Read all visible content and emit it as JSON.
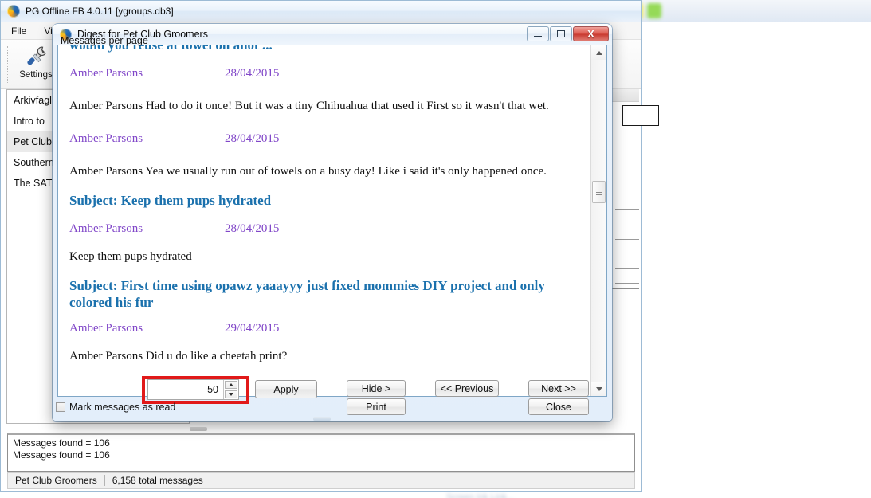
{
  "main_window": {
    "title": "PG Offline FB 4.0.11  [ygroups.db3]",
    "icon": "app-swirl-icon",
    "menu": [
      "File",
      "Vie"
    ],
    "toolbar": {
      "settings_label": "Settings",
      "settings_icon": "tools-settings-icon"
    },
    "group_list": [
      {
        "label": "Arkivfagl",
        "selected": false
      },
      {
        "label": "Intro to ",
        "selected": false
      },
      {
        "label": "Pet Club",
        "selected": true
      },
      {
        "label": "Southern",
        "selected": false
      },
      {
        "label": "The SAT",
        "selected": false
      }
    ],
    "log_lines": [
      "Messages found = 106",
      "Messages found = 106"
    ],
    "status_bar": {
      "group": "Pet Club Groomers",
      "total": "6,158 total messages"
    }
  },
  "dialog": {
    "title": "Digest for Pet Club Groomers",
    "icon": "app-swirl-icon",
    "window_buttons": {
      "minimize": "minimize-icon",
      "maximize": "maximize-icon",
      "close": "X"
    },
    "messages": [
      {
        "type": "subject",
        "clipped": true,
        "text": "would you reuse at towel on anot ..."
      },
      {
        "type": "meta",
        "author": "Amber Parsons",
        "date": "28/04/2015"
      },
      {
        "type": "body",
        "text": "Amber Parsons Had to do it once! But it was a tiny Chihuahua that used it First so it wasn't that wet."
      },
      {
        "type": "meta",
        "author": "Amber Parsons",
        "date": "28/04/2015"
      },
      {
        "type": "body",
        "text": "Amber Parsons Yea we usually run out of towels on a busy day! Like i said it's only happened once."
      },
      {
        "type": "subject",
        "clipped": false,
        "text": "Subject: Keep them pups hydrated"
      },
      {
        "type": "meta",
        "author": "Amber Parsons",
        "date": "28/04/2015"
      },
      {
        "type": "body",
        "text": "Keep them pups hydrated"
      },
      {
        "type": "subject",
        "clipped": false,
        "text": "Subject: First time using opawz yaaayyy just fixed mommies DIY project and only colored his fur"
      },
      {
        "type": "meta",
        "author": "Amber Parsons",
        "date": "29/04/2015"
      },
      {
        "type": "body",
        "text": "Amber Parsons Did u do like a cheetah print?"
      }
    ],
    "scrollbar": {
      "up_icon": "scroll-up-arrow-icon",
      "down_icon": "scroll-down-arrow-icon",
      "thumb": "scroll-thumb"
    },
    "footer": {
      "messages_per_page_label": "Messages per page",
      "messages_per_page_value": "50",
      "spinner_up_icon": "spinner-up-icon",
      "spinner_down_icon": "spinner-down-icon",
      "mark_read_label": "Mark messages as read",
      "mark_read_checked": false,
      "buttons": {
        "apply": "Apply",
        "hide": "Hide >",
        "print": "Print",
        "previous": "<< Previous",
        "next": "Next >>",
        "close": "Close"
      }
    }
  },
  "colors": {
    "subject": "#1b71ad",
    "author": "#8046c8",
    "highlight": "#e11919",
    "selection": "#ebebeb"
  },
  "background_swatches": [
    "#0d0d0d",
    "#9a9a9a",
    "#a8112a",
    "#e8293c",
    "#f08437",
    "#f2ef46",
    "#8fd94a"
  ]
}
